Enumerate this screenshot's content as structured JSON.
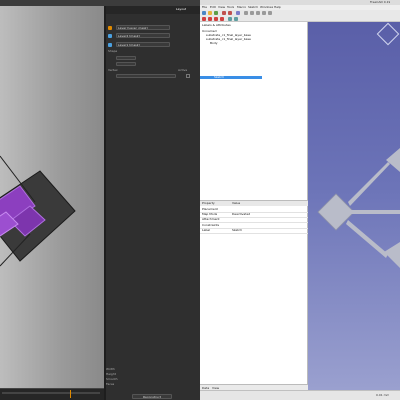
{
  "left_app": {
    "title": "",
    "panel": {
      "tabs": [
        "",
        "",
        "Layout"
      ],
      "properties": [
        {
          "label": "",
          "value": "Layer [Layer_mask]"
        },
        {
          "label": "",
          "value": "Layer2 [mask]"
        },
        {
          "label": "",
          "value": "Layer1 [mask]"
        }
      ],
      "section_label": "Shape",
      "subsection": "Vertex",
      "checkbox_label": "Active",
      "stats": [
        {
          "label": "Width",
          "value": ""
        },
        {
          "label": "Height",
          "value": ""
        },
        {
          "label": "Smooth",
          "value": ""
        },
        {
          "label": "Faces",
          "value": ""
        }
      ],
      "bottom_button": "Reconstruct"
    },
    "colors": {
      "accent": "#8c3fbf",
      "accent_light": "#b070e0",
      "orange": "#e08a00"
    }
  },
  "right_app": {
    "title": "FreeCAD 0.19",
    "menus": [
      "File",
      "Edit",
      "View",
      "Tools",
      "Macro",
      "Sketch",
      "Windows",
      "Help"
    ],
    "tree": {
      "header": "Labels & Attributes",
      "items": [
        {
          "label": "Unnamed"
        },
        {
          "label": "substrate_c1_final_layer_base"
        },
        {
          "label": "substrate_c1_final_layer_base"
        },
        {
          "label": "Body"
        },
        {
          "label": "Sketch",
          "selected": true
        }
      ]
    },
    "properties": {
      "header": [
        "Property",
        "Value"
      ],
      "rows": [
        {
          "name": "Placement",
          "value": ""
        },
        {
          "name": "Map Mode",
          "value": "Deactivated"
        },
        {
          "name": "Attachment",
          "value": ""
        },
        {
          "name": "Constraints",
          "value": ""
        },
        {
          "name": "Label",
          "value": "Sketch"
        }
      ]
    },
    "tabs": [
      "Data",
      "View"
    ],
    "status": {
      "preselected": "",
      "units": "0.01 mm"
    },
    "colors": {
      "view_top": "#5a5fa8",
      "view_bottom": "#9aa0cf",
      "shape": "#b9bcc9",
      "selection": "#3a8ee6"
    }
  }
}
